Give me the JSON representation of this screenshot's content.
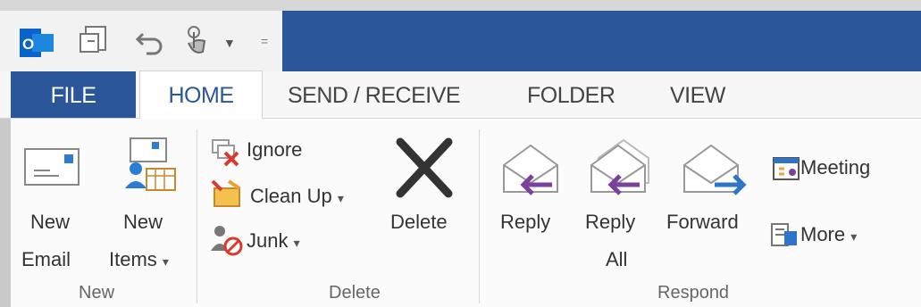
{
  "tabs": {
    "file": "FILE",
    "home": "HOME",
    "send_receive": "SEND / RECEIVE",
    "folder": "FOLDER",
    "view": "VIEW"
  },
  "ribbon": {
    "new_group": {
      "label": "New",
      "new_email": [
        "New",
        "Email"
      ],
      "new_items": [
        "New",
        "Items"
      ]
    },
    "delete_group": {
      "label": "Delete",
      "ignore": "Ignore",
      "clean_up": "Clean Up",
      "junk": "Junk",
      "delete": "Delete"
    },
    "respond_group": {
      "label": "Respond",
      "reply": "Reply",
      "reply_all": [
        "Reply",
        "All"
      ],
      "forward": "Forward",
      "meeting": "Meeting",
      "more": "More"
    }
  },
  "colors": {
    "outlook_blue": "#2b579a",
    "reply_arrow": "#7b3f9e",
    "forward_arrow": "#2e75c9",
    "delete_red": "#d83b2b"
  }
}
